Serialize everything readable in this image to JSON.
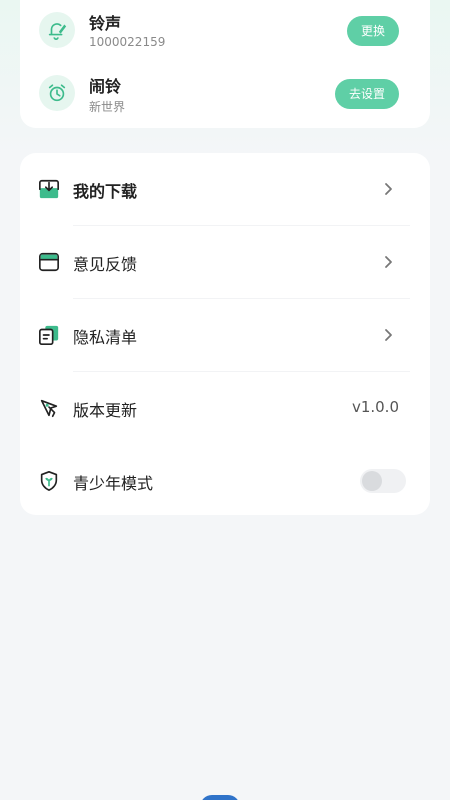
{
  "ringtone": {
    "title": "铃声",
    "subtitle": "1000022159",
    "button": "更换",
    "icon": "bell-edit-icon"
  },
  "alarm": {
    "title": "闹铃",
    "subtitle": "新世界",
    "button": "去设置",
    "icon": "alarm-clock-icon"
  },
  "menu": {
    "downloads": {
      "label": "我的下载",
      "icon": "download-box-icon"
    },
    "feedback": {
      "label": "意见反馈",
      "icon": "feedback-box-icon"
    },
    "privacy": {
      "label": "隐私清单",
      "icon": "document-list-icon"
    },
    "update": {
      "label": "版本更新",
      "icon": "rocket-icon",
      "version": "v1.0.0"
    },
    "teen_mode": {
      "label": "青少年模式",
      "icon": "shield-sprout-icon",
      "enabled": false
    }
  },
  "colors": {
    "accent": "#5fcfa6",
    "background": "#f4f6f8"
  }
}
